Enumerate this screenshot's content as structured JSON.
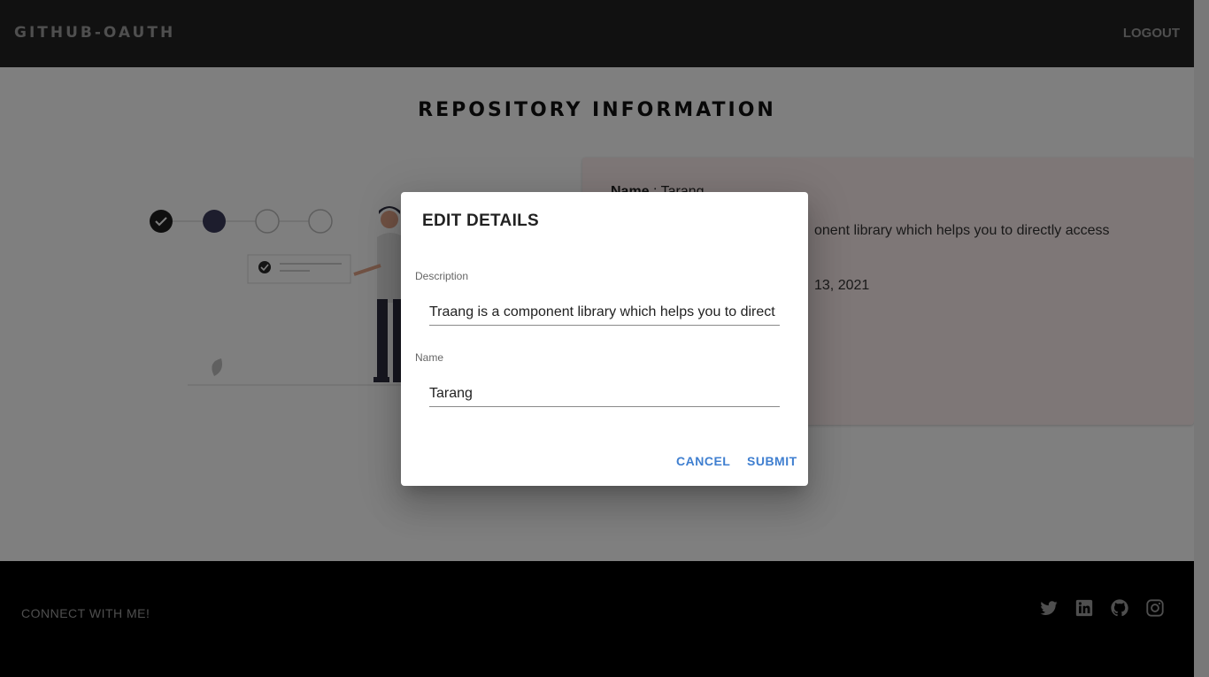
{
  "header": {
    "brand": "GITHUB-OAUTH",
    "logout_label": "LOGOUT"
  },
  "main": {
    "title": "REPOSITORY INFORMATION",
    "card": {
      "name_label": "Name",
      "name_value": "Tarang",
      "description_visible": "onent library which helps you to directly access",
      "date_visible": "13, 2021"
    }
  },
  "footer": {
    "connect_label": "CONNECT WITH ME!",
    "icons": [
      "twitter-icon",
      "linkedin-icon",
      "github-icon",
      "instagram-icon"
    ]
  },
  "dialog": {
    "title": "EDIT DETAILS",
    "description_label": "Description",
    "description_value": "Traang is a component library which helps you to direct",
    "name_label": "Name",
    "name_value": "Tarang",
    "cancel_label": "CANCEL",
    "submit_label": "SUBMIT"
  },
  "colors": {
    "accent": "#3f7fd0",
    "header_bg": "#222222",
    "footer_bg": "#000000",
    "card_bg": "#fdeeee"
  }
}
